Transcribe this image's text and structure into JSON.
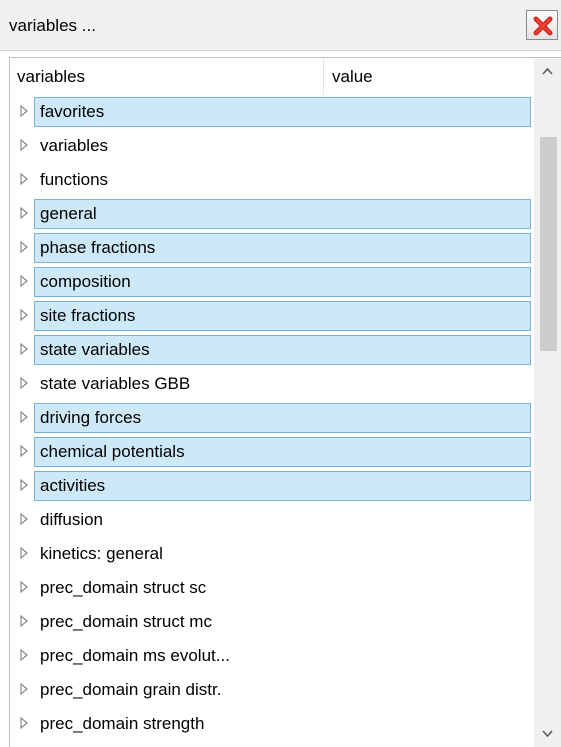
{
  "window": {
    "title": "variables ..."
  },
  "table": {
    "headers": {
      "col1": "variables",
      "col2": "value"
    },
    "rows": [
      {
        "label": "favorites",
        "highlighted": true
      },
      {
        "label": "variables",
        "highlighted": false
      },
      {
        "label": "functions",
        "highlighted": false
      },
      {
        "label": "general",
        "highlighted": true
      },
      {
        "label": "phase fractions",
        "highlighted": true
      },
      {
        "label": "composition",
        "highlighted": true
      },
      {
        "label": "site fractions",
        "highlighted": true
      },
      {
        "label": "state variables",
        "highlighted": true
      },
      {
        "label": "state variables GBB",
        "highlighted": false
      },
      {
        "label": "driving forces",
        "highlighted": true
      },
      {
        "label": "chemical potentials",
        "highlighted": true
      },
      {
        "label": "activities",
        "highlighted": true
      },
      {
        "label": "diffusion",
        "highlighted": false
      },
      {
        "label": "kinetics: general",
        "highlighted": false
      },
      {
        "label": "prec_domain struct sc",
        "highlighted": false
      },
      {
        "label": "prec_domain struct mc",
        "highlighted": false
      },
      {
        "label": "prec_domain ms evolut...",
        "highlighted": false
      },
      {
        "label": "prec_domain grain distr.",
        "highlighted": false
      },
      {
        "label": "prec_domain strength",
        "highlighted": false
      }
    ]
  },
  "colors": {
    "highlight_fill": "#cde8f7",
    "highlight_border": "#7ab3d6",
    "close_icon": "#d9261c"
  },
  "icons": {
    "close": "red-x-icon",
    "expand": "expand-triangle-icon",
    "scroll_up": "chevron-up-icon",
    "scroll_down": "chevron-down-icon"
  }
}
